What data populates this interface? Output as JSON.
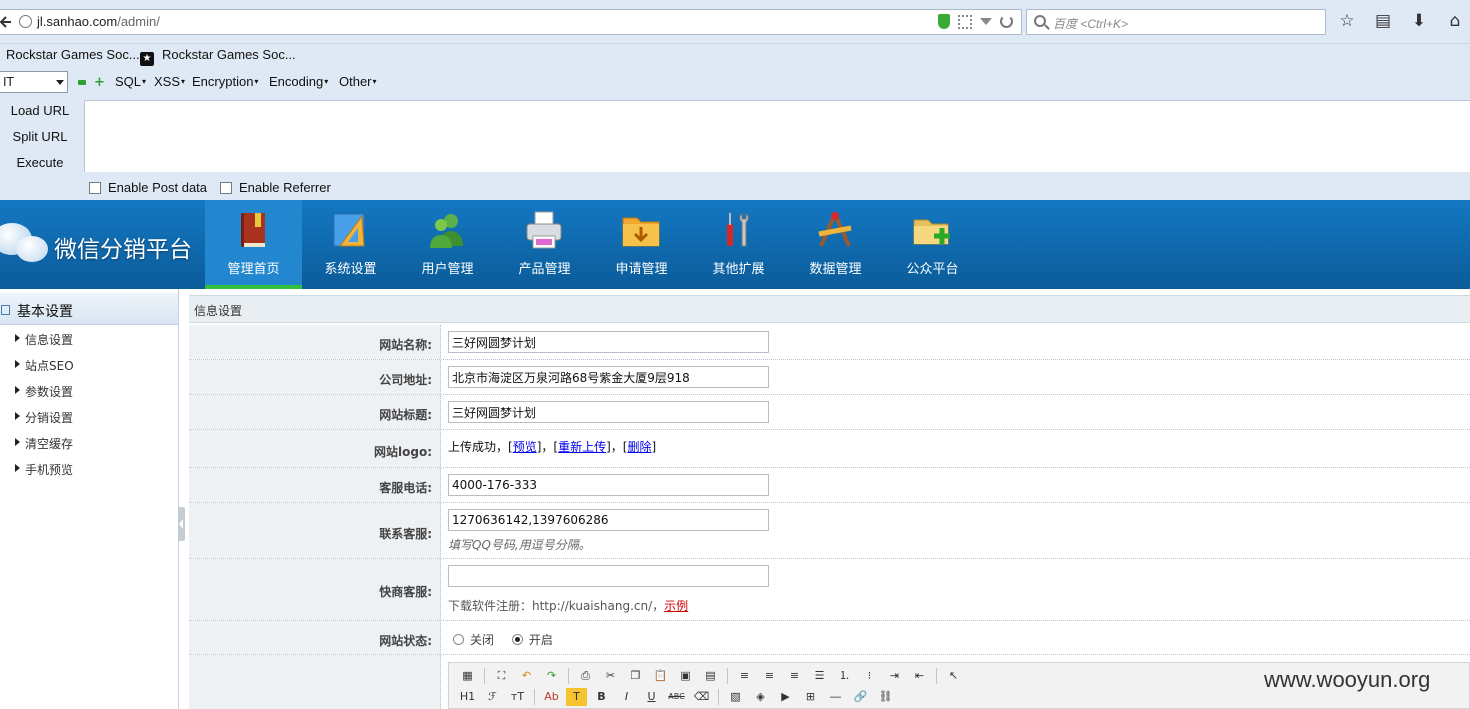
{
  "browser": {
    "url_host": "jl.sanhao.com",
    "url_path": "/admin/",
    "search_placeholder": "百度 <Ctrl+K>"
  },
  "bookmarks": [
    {
      "label": "Rockstar Games Soc..."
    },
    {
      "label": "Rockstar Games Soc..."
    }
  ],
  "hackbar": {
    "select_value": "IT",
    "menus": [
      "SQL",
      "XSS",
      "Encryption",
      "Encoding",
      "Other"
    ],
    "actions": [
      "Load URL",
      "Split URL",
      "Execute"
    ],
    "checks": [
      "Enable Post data",
      "Enable Referrer"
    ]
  },
  "app": {
    "logo_title": "微信分销平台",
    "nav": [
      {
        "label": "管理首页",
        "icon": "book-icon"
      },
      {
        "label": "系统设置",
        "icon": "ruler-icon"
      },
      {
        "label": "用户管理",
        "icon": "users-icon"
      },
      {
        "label": "产品管理",
        "icon": "printer-icon"
      },
      {
        "label": "申请管理",
        "icon": "folder-download-icon"
      },
      {
        "label": "其他扩展",
        "icon": "tools-icon"
      },
      {
        "label": "数据管理",
        "icon": "compass-icon"
      },
      {
        "label": "公众平台",
        "icon": "folder-add-icon"
      }
    ]
  },
  "sidebar": {
    "title": "基本设置",
    "items": [
      "信息设置",
      "站点SEO",
      "参数设置",
      "分销设置",
      "清空缓存",
      "手机预览"
    ]
  },
  "form": {
    "title": "信息设置",
    "site_name_label": "网站名称:",
    "site_name_value": "三好网圆梦计划",
    "address_label": "公司地址:",
    "address_value": "北京市海淀区万泉河路68号紫金大厦9层918",
    "site_title_label": "网站标题:",
    "site_title_value": "三好网圆梦计划",
    "logo_label": "网站logo:",
    "logo_status": "上传成功，",
    "logo_preview": "预览",
    "logo_reupload": "重新上传",
    "logo_delete": "删除",
    "phone_label": "客服电话:",
    "phone_value": "4000-176-333",
    "qq_label": "联系客服:",
    "qq_value": "1270636142,1397606286",
    "qq_hint": "填写QQ号码,用逗号分隔。",
    "kuai_label": "快商客服:",
    "kuai_value": "",
    "kuai_text": "下载软件注册：http://kuaishang.cn/，",
    "kuai_example": "示例",
    "status_label": "网站状态:",
    "status_off": "关闭",
    "status_on": "开启"
  },
  "editor": {
    "row2": [
      "H1",
      "ℱ",
      "тT",
      "Ab",
      "T",
      "B",
      "I",
      "U",
      "ABC"
    ]
  },
  "watermark": "www.wooyun.org",
  "colors": {
    "header_blue": "#1478c2",
    "active_green": "#33c03d",
    "link": "#0000ee",
    "example_red": "#d40000"
  }
}
